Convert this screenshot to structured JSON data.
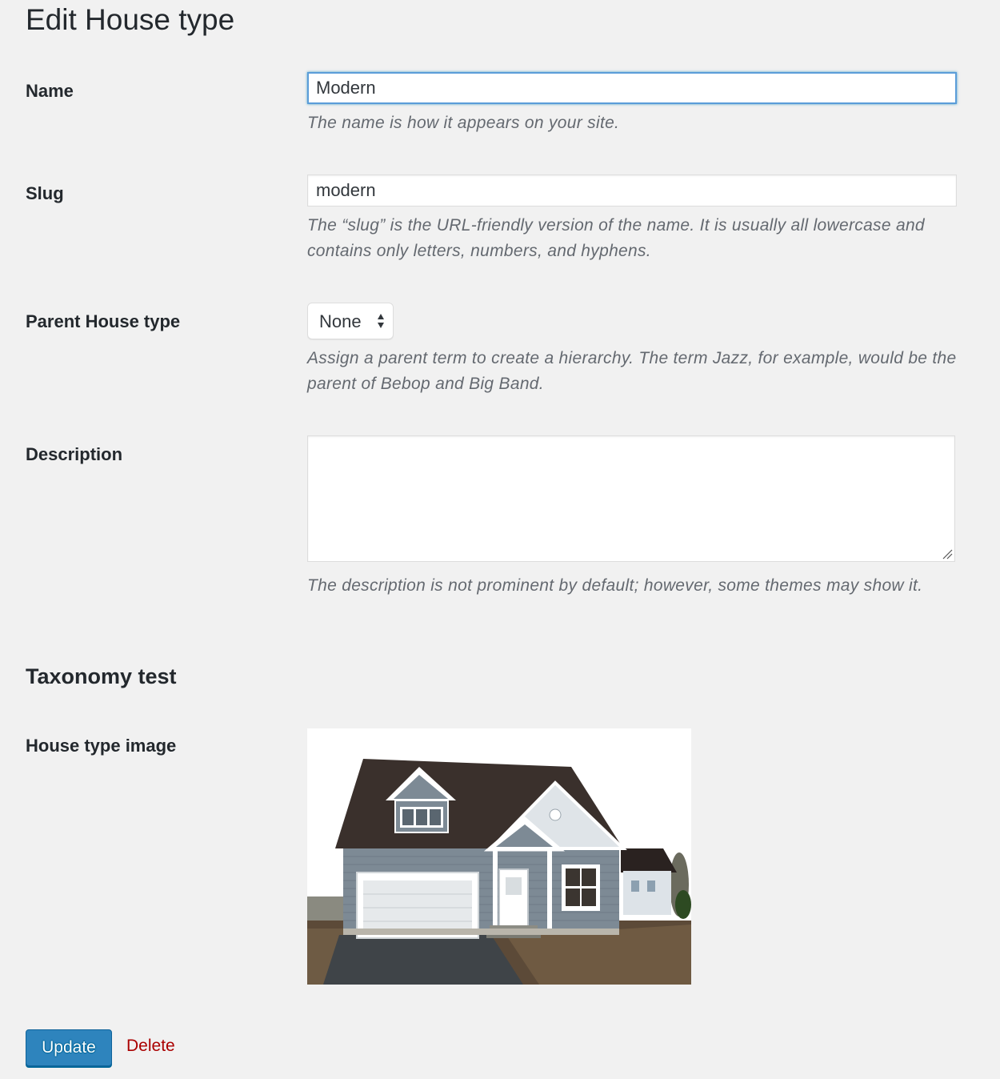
{
  "page": {
    "title": "Edit House type"
  },
  "form": {
    "name": {
      "label": "Name",
      "value": "Modern",
      "help": "The name is how it appears on your site."
    },
    "slug": {
      "label": "Slug",
      "value": "modern",
      "help": "The “slug” is the URL-friendly version of the name. It is usually all lowercase and contains only letters, numbers, and hyphens."
    },
    "parent": {
      "label": "Parent House type",
      "selected": "None",
      "help": "Assign a parent term to create a hierarchy. The term Jazz, for example, would be the parent of Bebop and Big Band."
    },
    "description": {
      "label": "Description",
      "value": "",
      "help": "The description is not prominent by default; however, some themes may show it."
    }
  },
  "taxonomy_section": {
    "heading": "Taxonomy test",
    "image_label": "House type image",
    "image_subject": "house-photo"
  },
  "actions": {
    "update_label": "Update",
    "delete_label": "Delete"
  },
  "colors": {
    "background": "#f1f1f1",
    "primary_button": "#2e84bd",
    "delete_link": "#aa0000",
    "focus_border": "#5b9dd9",
    "help_text": "#646970"
  }
}
